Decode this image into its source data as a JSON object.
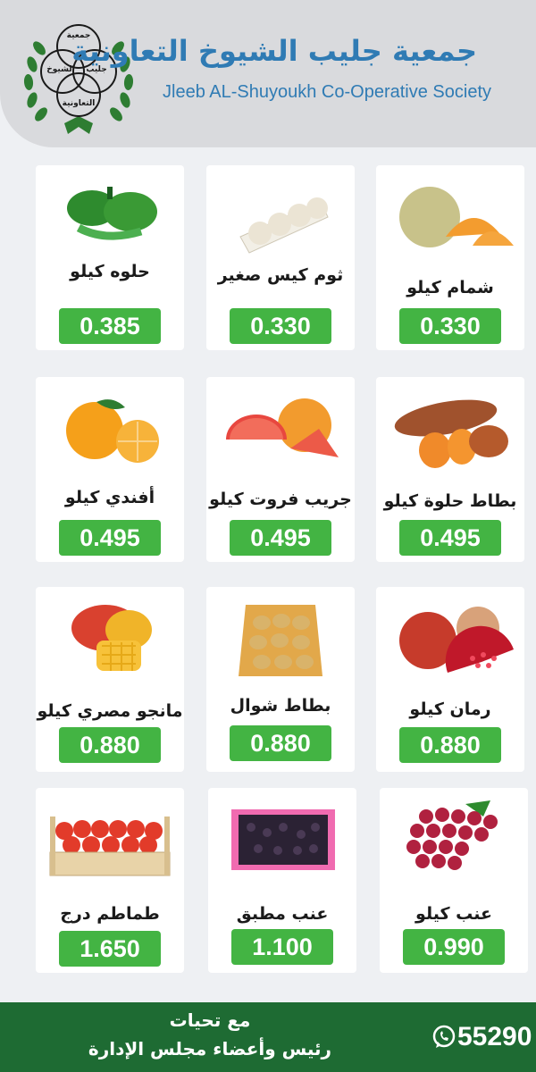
{
  "header": {
    "logo_text": [
      "جمعية",
      "جليب",
      "الشيوخ",
      "التعاونية"
    ],
    "title_ar": "جمعية جليب الشيوخ التعاونية",
    "title_en": "Jleeb AL-Shuyoukh Co-Operative Society"
  },
  "products": [
    {
      "name": "حلوه كيلو",
      "price": "0.385",
      "icon": "green-bell-pepper-image"
    },
    {
      "name": "ثوم كيس صغير",
      "price": "0.330",
      "icon": "garlic-bag-image"
    },
    {
      "name": "شمام كيلو",
      "price": "0.330",
      "icon": "cantaloupe-image"
    },
    {
      "name": "أفندي كيلو",
      "price": "0.495",
      "icon": "mandarin-image"
    },
    {
      "name": "جريب فروت كيلو",
      "price": "0.495",
      "icon": "grapefruit-image"
    },
    {
      "name": "بطاط حلوة كيلو",
      "price": "0.495",
      "icon": "sweet-potato-image"
    },
    {
      "name": "مانجو مصري كيلو",
      "price": "0.880",
      "icon": "mango-image"
    },
    {
      "name": "بطاط شوال",
      "price": "0.880",
      "icon": "potato-sack-image"
    },
    {
      "name": "رمان كيلو",
      "price": "0.880",
      "icon": "pomegranate-image"
    },
    {
      "name": "طماطم درج",
      "price": "1.650",
      "icon": "tomato-crate-image"
    },
    {
      "name": "عنب مطبق",
      "price": "1.100",
      "icon": "grape-box-image"
    },
    {
      "name": "عنب كيلو",
      "price": "0.990",
      "icon": "red-grapes-image"
    }
  ],
  "footer": {
    "line1": "مع تحيات",
    "line2": "رئيس وأعضاء مجلس الإدارة",
    "phone": "55290",
    "icon": "whatsapp-icon"
  },
  "colors": {
    "brand_blue": "#2f7bb4",
    "price_green": "#43b443",
    "footer_green": "#1e6b33"
  }
}
